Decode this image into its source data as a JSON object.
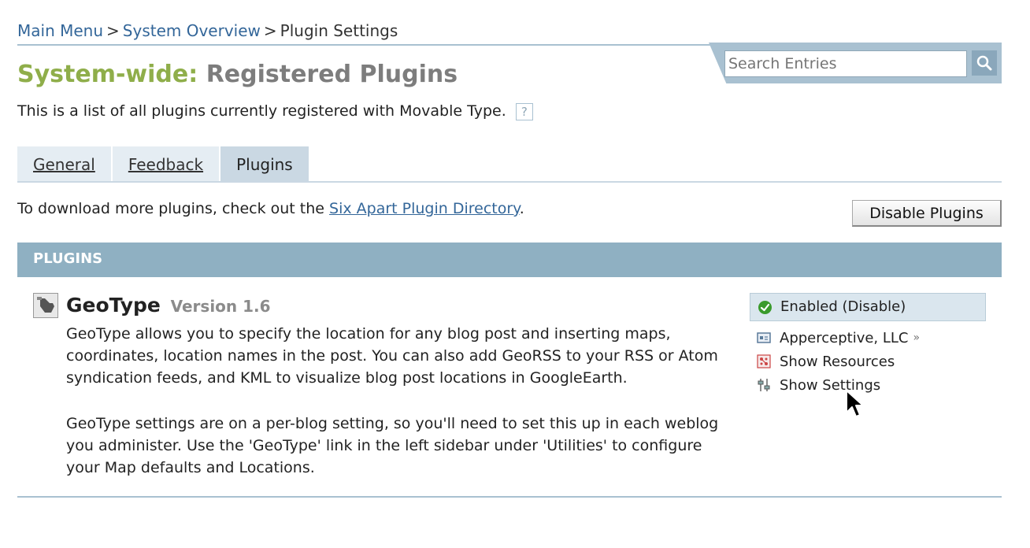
{
  "breadcrumb": {
    "items": [
      "Main Menu",
      "System Overview"
    ],
    "separator": ">",
    "current": "Plugin Settings"
  },
  "search": {
    "placeholder": "Search Entries",
    "icon": "search-icon"
  },
  "page": {
    "title_scope": "System-wide:",
    "title": "Registered Plugins",
    "intro": "This is a list of all plugins currently registered with Movable Type.",
    "help_label": "?"
  },
  "tabs": [
    {
      "label": "General",
      "active": false
    },
    {
      "label": "Feedback",
      "active": false
    },
    {
      "label": "Plugins",
      "active": true
    }
  ],
  "download": {
    "prefix": "To download more plugins, check out the",
    "link": "Six Apart Plugin Directory",
    "suffix": "."
  },
  "actions": {
    "disable_plugins": "Disable Plugins"
  },
  "section": {
    "heading": "PLUGINS"
  },
  "plugin": {
    "name": "GeoType",
    "version": "Version 1.6",
    "description_1": "GeoType allows you to specify the location for any blog post and inserting maps, coordinates, location names in the post. You can also add GeoRSS to your RSS or Atom syndication feeds, and KML to visualize blog post locations in GoogleEarth.",
    "description_2": "GeoType settings are on a per-blog setting, so you'll need to set this up in each weblog you administer. Use the 'GeoType' link in the left sidebar under 'Utilities' to configure your Map defaults and Locations.",
    "status": "Enabled (Disable)",
    "author": "Apperceptive, LLC",
    "author_arrow": "»",
    "show_resources": "Show Resources",
    "show_settings": "Show Settings"
  },
  "colors": {
    "link": "#336699",
    "scope_green": "#8fae4a",
    "section_bar": "#8fb0c2",
    "enabled_green": "#3a9b2c"
  }
}
